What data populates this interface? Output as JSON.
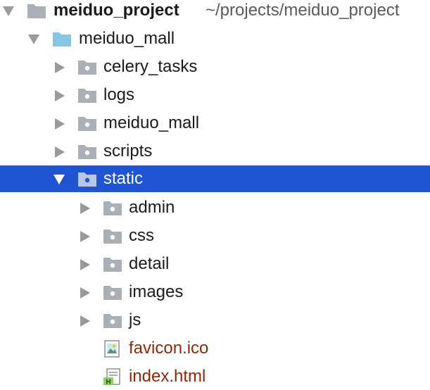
{
  "project_tree": {
    "root": {
      "label": "meiduo_project",
      "path": "~/projects/meiduo_project",
      "icon": "folder-icon"
    },
    "items": [
      {
        "label": "meiduo_mall",
        "icon": "module-folder-icon",
        "expanded": true
      },
      {
        "label": "celery_tasks",
        "icon": "package-folder-icon",
        "expanded": false
      },
      {
        "label": "logs",
        "icon": "package-folder-icon",
        "expanded": false
      },
      {
        "label": "meiduo_mall",
        "icon": "package-folder-icon",
        "expanded": false
      },
      {
        "label": "scripts",
        "icon": "package-folder-icon",
        "expanded": false
      },
      {
        "label": "static",
        "icon": "package-folder-icon",
        "expanded": true,
        "selected": true
      },
      {
        "label": "admin",
        "icon": "package-folder-icon",
        "expanded": false
      },
      {
        "label": "css",
        "icon": "package-folder-icon",
        "expanded": false
      },
      {
        "label": "detail",
        "icon": "package-folder-icon",
        "expanded": false
      },
      {
        "label": "images",
        "icon": "package-folder-icon",
        "expanded": false
      },
      {
        "label": "js",
        "icon": "package-folder-icon",
        "expanded": false
      },
      {
        "label": "favicon.ico",
        "icon": "image-file-icon"
      },
      {
        "label": "index.html",
        "icon": "html-file-icon"
      }
    ]
  },
  "colors": {
    "selection": "#1f55d3",
    "folder": "#a9b0b8",
    "module_folder": "#86c7e6",
    "file_text": "#8c2a07"
  }
}
